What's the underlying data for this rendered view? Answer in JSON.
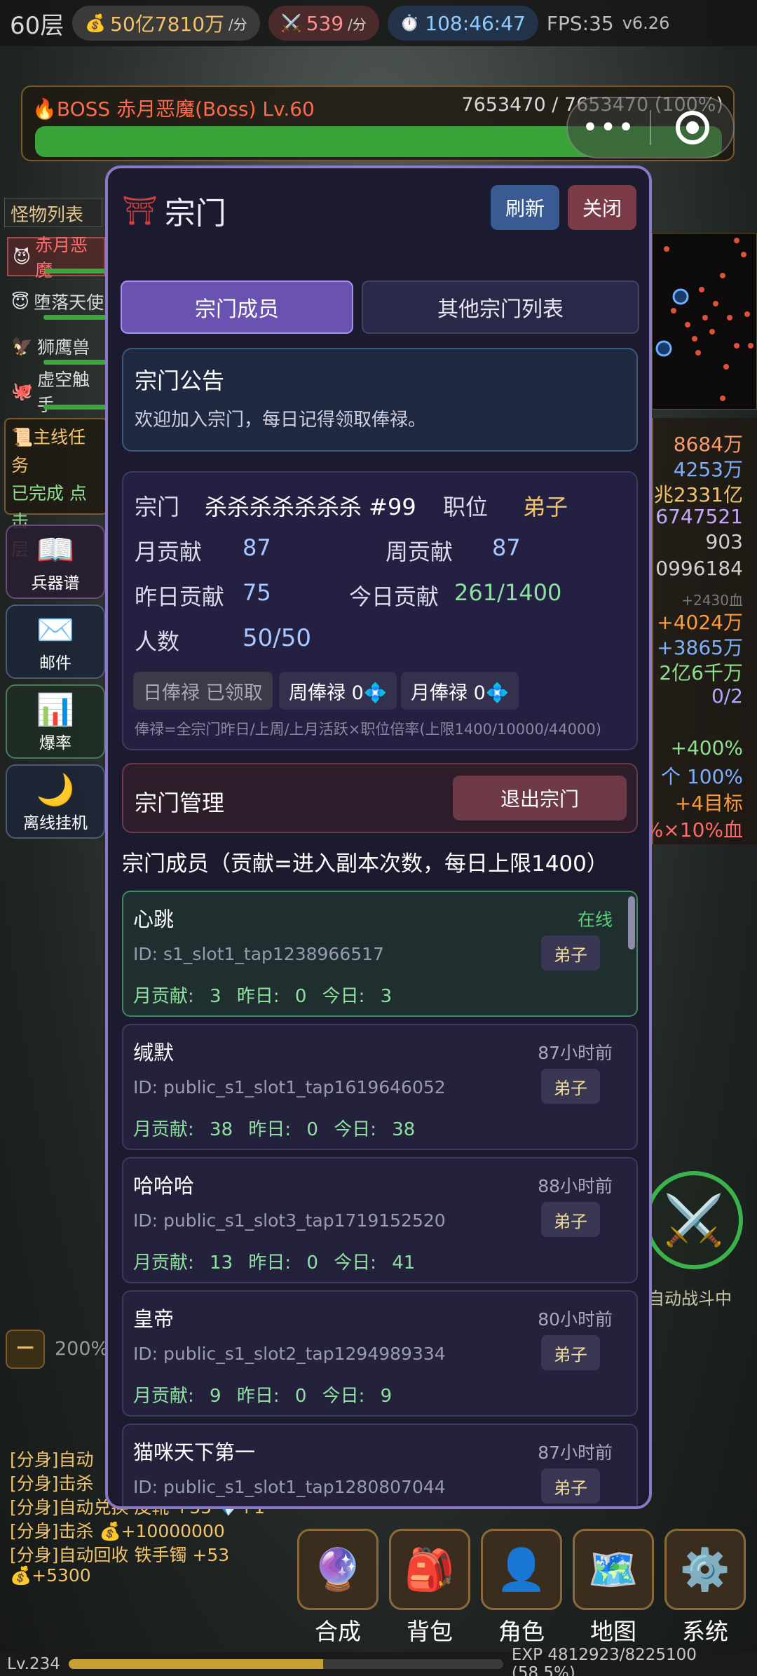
{
  "topbar": {
    "floor": "60层",
    "gold_rate": "50亿7810万",
    "gold_unit": "/分",
    "kill_rate": "539",
    "kill_unit": "/分",
    "timer": "108:46:47",
    "fps": "FPS:35",
    "version": "v6.26"
  },
  "boss": {
    "name": "BOSS 赤月恶魔(Boss) Lv.60",
    "hp_text": "7653470 / 7653470  (100%)",
    "hp_fraction": 1.0
  },
  "capsule": {
    "dots": "•••"
  },
  "monsters": {
    "title": "怪物列表",
    "items": [
      {
        "icon": "😈",
        "name": "赤月恶魔",
        "color": "#ff6a6a"
      },
      {
        "icon": "😇",
        "name": "堕落天使",
        "color": "#dcdcdc"
      },
      {
        "icon": "🦅",
        "name": "狮鹰兽",
        "color": "#dcdcdc"
      },
      {
        "icon": "🐙",
        "name": "虚空触手",
        "color": "#dcdcdc"
      }
    ]
  },
  "quest": {
    "line1": "主线任务",
    "line2": "已完成 点击",
    "line3": "层"
  },
  "side_buttons": [
    {
      "icon": "📖",
      "label": "兵器谱"
    },
    {
      "icon": "✉️",
      "label": "邮件"
    },
    {
      "icon": "📊",
      "label": "爆率"
    },
    {
      "icon": "🌙",
      "label": "离线挂机"
    }
  ],
  "zoom": {
    "minus": "−",
    "percent": "200%"
  },
  "right_stats": [
    {
      "text": "8684万",
      "color": "#ff9a6a"
    },
    {
      "text": "4253万",
      "color": "#7ab0ff"
    },
    {
      "text": "兆2331亿",
      "color": "#f1c36a"
    },
    {
      "text": "6747521",
      "color": "#c8a8ff"
    },
    {
      "text": "903",
      "color": "#d0d0d0"
    },
    {
      "text": "0996184",
      "color": "#d0d0d0"
    },
    {
      "text": "+2430血",
      "color": "#7a7a7a"
    },
    {
      "text": "+4024万",
      "color": "#ff9a3a"
    },
    {
      "text": "+3865万",
      "color": "#7ab0ff"
    },
    {
      "text": "2亿6千万",
      "color": "#8ee08e"
    },
    {
      "text": "0/2",
      "color": "#b0a8ff"
    },
    {
      "text": "+400%",
      "color": "#8ee08e"
    },
    {
      "text": "个 100%",
      "color": "#7ab0ff"
    },
    {
      "text": "+4目标",
      "color": "#ff9a3a"
    },
    {
      "text": "%×10%血",
      "color": "#ff6a6a"
    }
  ],
  "battle": {
    "icon": "⚔️",
    "label": "自动战斗中"
  },
  "logs": [
    {
      "text": "[分身]自动",
      "color": "#f1c36a"
    },
    {
      "text": "[分身]击杀",
      "color": "#f1c36a"
    },
    {
      "text": "[分身]自动兑换 皮靴 +55 💎+1",
      "color": "#f1c36a"
    },
    {
      "text": "[分身]击杀 💰+10000000",
      "color": "#f1c36a"
    },
    {
      "text": "[分身]自动回收 铁手镯 +53",
      "color": "#f1c36a"
    },
    {
      "text": "💰+5300",
      "color": "#f1c36a"
    }
  ],
  "bottom_nav": [
    {
      "icon": "🔮",
      "label": "合成"
    },
    {
      "icon": "🎒",
      "label": "背包"
    },
    {
      "icon": "👤",
      "label": "角色"
    },
    {
      "icon": "🗺️",
      "label": "地图"
    },
    {
      "icon": "⚙️",
      "label": "系统"
    }
  ],
  "xp": {
    "level": "Lv.234",
    "text": "EXP 4812923/8225100 (58.5%)",
    "fraction": 0.585
  },
  "sect": {
    "title": "宗门",
    "refresh": "刷新",
    "close": "关闭",
    "tab_members": "宗门成员",
    "tab_others": "其他宗门列表",
    "notice_title": "宗门公告",
    "notice_text": "欢迎加入宗门，每日记得领取俸禄。",
    "label_sect": "宗门",
    "sect_name": "杀杀杀杀杀杀杀 #99",
    "label_position": "职位",
    "position": "弟子",
    "label_month": "月贡献",
    "month": "87",
    "label_week": "周贡献",
    "week": "87",
    "label_yesterday": "昨日贡献",
    "yesterday": "75",
    "label_today": "今日贡献",
    "today": "261/1400",
    "label_count": "人数",
    "count": "50/50",
    "daily_salary": "日俸禄 已领取",
    "weekly_salary": "周俸禄 0💠",
    "monthly_salary": "月俸禄 0💠",
    "salary_note": "俸禄=全宗门昨日/上周/上月活跃×职位倍率(上限1400/10000/44000)",
    "manage_title": "宗门管理",
    "leave": "退出宗门",
    "members_header": "宗门成员（贡献=进入副本次数，每日上限1400）",
    "members": [
      {
        "name": "心跳",
        "status": "在线",
        "id": "ID: s1_slot1_tap1238966517",
        "role": "弟子",
        "contrib": "月贡献: 3  昨日: 0  今日: 3"
      },
      {
        "name": "缄默",
        "status": "87小时前",
        "id": "ID: public_s1_slot1_tap1619646052",
        "role": "弟子",
        "contrib": "月贡献: 38  昨日: 0  今日: 38"
      },
      {
        "name": "哈哈哈",
        "status": "88小时前",
        "id": "ID: public_s1_slot3_tap1719152520",
        "role": "弟子",
        "contrib": "月贡献: 13  昨日: 0  今日: 41"
      },
      {
        "name": "皇帝",
        "status": "80小时前",
        "id": "ID: public_s1_slot2_tap1294989334",
        "role": "弟子",
        "contrib": "月贡献: 9  昨日: 0  今日: 9"
      },
      {
        "name": "猫咪天下第一",
        "status": "87小时前",
        "id": "ID: public_s1_slot1_tap1280807044",
        "role": "弟子",
        "contrib": ""
      }
    ]
  }
}
